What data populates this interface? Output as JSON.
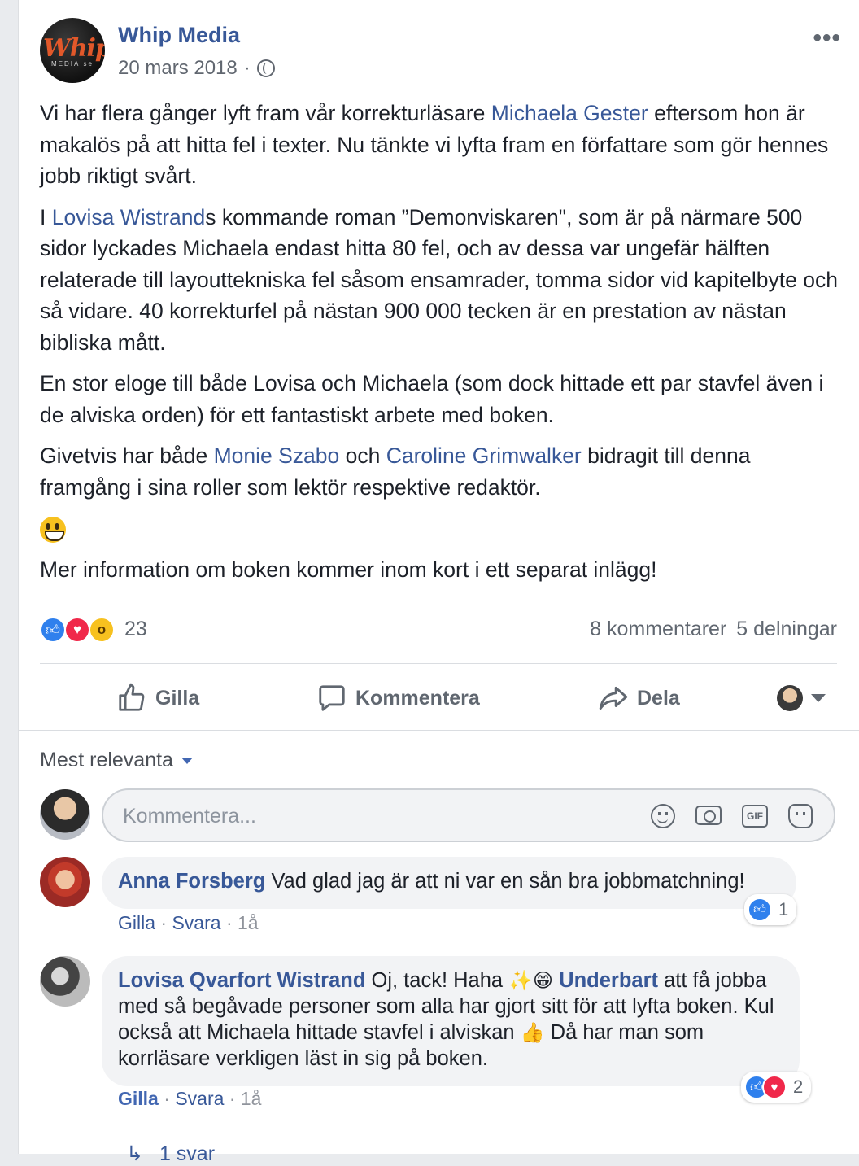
{
  "post": {
    "page_name": "Whip Media",
    "logo_text": "Whip",
    "logo_subtext": "MEDIA.se",
    "date": "20 mars 2018",
    "separator": "·",
    "more_label": "•••",
    "paragraphs": {
      "p1_a": "Vi har flera gånger lyft fram vår korrekturläsare ",
      "p1_link": "Michaela Gester",
      "p1_b": " eftersom hon är makalös på att hitta fel i texter. Nu tänkte vi lyfta fram en författare som gör hennes jobb riktigt svårt.",
      "p2_a": "I ",
      "p2_link": "Lovisa Wistrand",
      "p2_b": "s kommande roman ”Demonviskaren\", som är på närmare 500 sidor lyckades Michaela endast hitta 80 fel, och av dessa var ungefär hälften relaterade till layouttekniska fel såsom ensamrader, tomma sidor vid kapitelbyte och så vidare. 40 korrekturfel på nästan 900 000 tecken är en prestation av nästan bibliska mått.",
      "p3": "En stor eloge till både Lovisa och Michaela (som dock hittade ett par stavfel även i de alviska orden) för ett fantastiskt arbete med boken.",
      "p4_a": "Givetvis har både ",
      "p4_link1": "Monie Szabo",
      "p4_b": " och ",
      "p4_link2": "Caroline Grimwalker",
      "p4_c": " bidragit till denna framgång i sina roller som lektör respektive redaktör.",
      "p6": "Mer information om boken kommer inom kort i ett separat inlägg!"
    },
    "reaction_count": "23",
    "comments_count": "8 kommentarer",
    "shares_count": "5 delningar"
  },
  "actions": {
    "like": "Gilla",
    "comment": "Kommentera",
    "share": "Dela"
  },
  "comments_section": {
    "sort_label": "Mest relevanta",
    "composer_placeholder": "Kommentera...",
    "gif_label": "GIF"
  },
  "comments": [
    {
      "author": "Anna Forsberg",
      "text": " Vad glad jag är att ni var en sån bra jobbmatchning!",
      "like": "Gilla",
      "reply": "Svara",
      "time": "1å",
      "reaction_count": "1"
    },
    {
      "author": "Lovisa Qvarfort Wistrand",
      "text_a": " Oj, tack! Haha ",
      "emoji_a": "✨😁",
      "mention": "Underbart",
      "text_b": " att få jobba med så begåvade personer som alla har gjort sitt för att lyfta boken. Kul också att Michaela hittade stavfel i alviskan ",
      "emoji_b": "👍",
      "text_c": " Då har man som korrläsare verkligen läst in sig på boken.",
      "like": "Gilla",
      "reply": "Svara",
      "time": "1å",
      "reaction_count": "2"
    }
  ],
  "replies": {
    "arrow": "↳",
    "label": "1 svar"
  },
  "colors": {
    "link": "#385898",
    "like_blue": "#2f80ed",
    "love_red": "#f0284a",
    "wow_yellow": "#f7c11f"
  }
}
